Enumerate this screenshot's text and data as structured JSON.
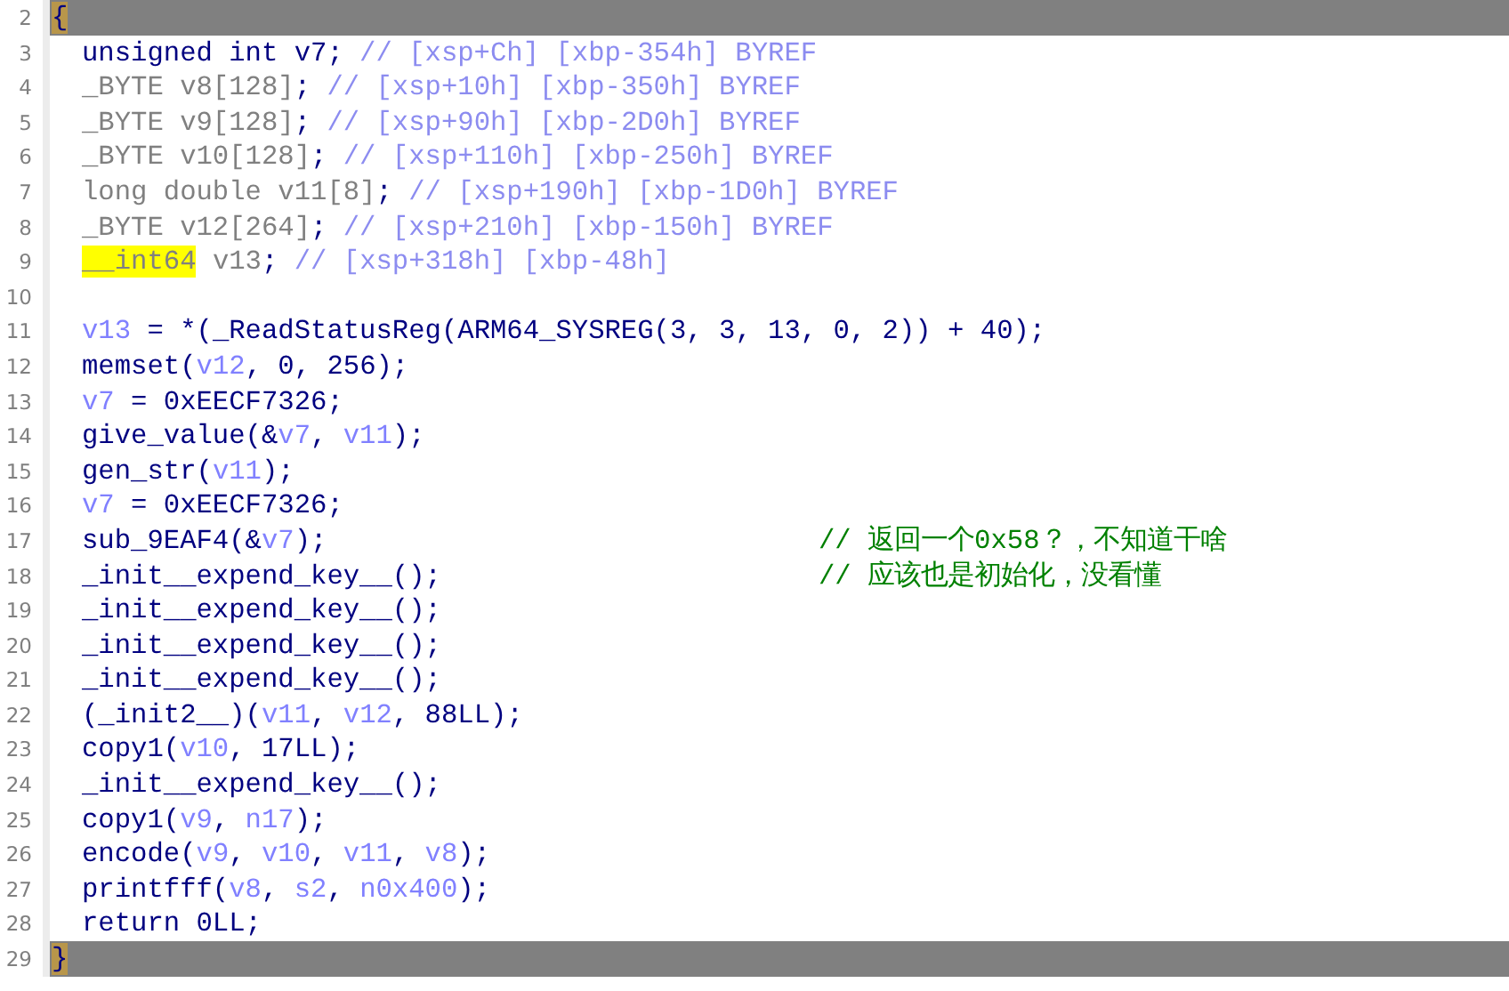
{
  "lines": [
    {
      "number": "2",
      "kind": "brace",
      "highlighted": true,
      "tokens": [
        {
          "kind": "plain",
          "text": "{",
          "cursor": true
        }
      ]
    },
    {
      "number": "3",
      "kind": "statement",
      "highlighted": false,
      "tokens": [
        {
          "kind": "keyword",
          "text": "unsigned int v7;"
        },
        {
          "kind": "comment",
          "text": " // [xsp+Ch] [xbp-354h] BYREF"
        }
      ]
    },
    {
      "number": "4",
      "kind": "statement",
      "highlighted": false,
      "tokens": [
        {
          "kind": "type",
          "text": "_BYTE v8[128]"
        },
        {
          "kind": "plain",
          "text": ";"
        },
        {
          "kind": "comment",
          "text": " // [xsp+10h] [xbp-350h] BYREF"
        }
      ]
    },
    {
      "number": "5",
      "kind": "statement",
      "highlighted": false,
      "tokens": [
        {
          "kind": "type",
          "text": "_BYTE v9[128]"
        },
        {
          "kind": "plain",
          "text": ";"
        },
        {
          "kind": "comment",
          "text": " // [xsp+90h] [xbp-2D0h] BYREF"
        }
      ]
    },
    {
      "number": "6",
      "kind": "statement",
      "highlighted": false,
      "tokens": [
        {
          "kind": "type",
          "text": "_BYTE v10[128]"
        },
        {
          "kind": "plain",
          "text": ";"
        },
        {
          "kind": "comment",
          "text": " // [xsp+110h] [xbp-250h] BYREF"
        }
      ]
    },
    {
      "number": "7",
      "kind": "statement",
      "highlighted": false,
      "tokens": [
        {
          "kind": "type",
          "text": "long double v11[8]"
        },
        {
          "kind": "plain",
          "text": ";"
        },
        {
          "kind": "comment",
          "text": " // [xsp+190h] [xbp-1D0h] BYREF"
        }
      ]
    },
    {
      "number": "8",
      "kind": "statement",
      "highlighted": false,
      "tokens": [
        {
          "kind": "type",
          "text": "_BYTE v12[264]"
        },
        {
          "kind": "plain",
          "text": ";"
        },
        {
          "kind": "comment",
          "text": " // [xsp+210h] [xbp-150h] BYREF"
        }
      ]
    },
    {
      "number": "9",
      "kind": "statement",
      "highlighted": false,
      "tokens": [
        {
          "kind": "type",
          "text": "__int64",
          "marked": true
        },
        {
          "kind": "type",
          "text": " v13"
        },
        {
          "kind": "plain",
          "text": ";"
        },
        {
          "kind": "comment",
          "text": " // [xsp+318h] [xbp-48h]"
        }
      ]
    },
    {
      "number": "10",
      "kind": "statement",
      "highlighted": false
    },
    {
      "number": "11",
      "kind": "statement",
      "highlighted": false,
      "tokens": [
        {
          "kind": "var",
          "text": "v13"
        },
        {
          "kind": "plain",
          "text": " = *(_ReadStatusReg(ARM64_SYSREG(3, 3, 13, 0, 2)) + 40);"
        }
      ]
    },
    {
      "number": "12",
      "kind": "statement",
      "highlighted": false,
      "tokens": [
        {
          "kind": "plain",
          "text": "memset("
        },
        {
          "kind": "var",
          "text": "v12"
        },
        {
          "kind": "plain",
          "text": ", 0, 256);"
        }
      ]
    },
    {
      "number": "13",
      "kind": "statement",
      "highlighted": false,
      "tokens": [
        {
          "kind": "var",
          "text": "v7"
        },
        {
          "kind": "plain",
          "text": " = 0xEECF7326;"
        }
      ]
    },
    {
      "number": "14",
      "kind": "statement",
      "highlighted": false,
      "tokens": [
        {
          "kind": "plain",
          "text": "give_value(&"
        },
        {
          "kind": "var",
          "text": "v7"
        },
        {
          "kind": "plain",
          "text": ", "
        },
        {
          "kind": "var",
          "text": "v11"
        },
        {
          "kind": "plain",
          "text": ");"
        }
      ]
    },
    {
      "number": "15",
      "kind": "statement",
      "highlighted": false,
      "tokens": [
        {
          "kind": "plain",
          "text": "gen_str("
        },
        {
          "kind": "var",
          "text": "v11"
        },
        {
          "kind": "plain",
          "text": ");"
        }
      ]
    },
    {
      "number": "16",
      "kind": "statement",
      "highlighted": false,
      "tokens": [
        {
          "kind": "var",
          "text": "v7"
        },
        {
          "kind": "plain",
          "text": " = 0xEECF7326;"
        }
      ]
    },
    {
      "number": "17",
      "kind": "statement",
      "highlighted": false,
      "tokens": [
        {
          "kind": "plain",
          "text": "sub_9EAF4(&"
        },
        {
          "kind": "var",
          "text": "v7"
        },
        {
          "kind": "plain",
          "text": ");"
        }
      ],
      "comment": "// 返回一个0x58？，不知道干啥"
    },
    {
      "number": "18",
      "kind": "statement",
      "highlighted": false,
      "tokens": [
        {
          "kind": "plain",
          "text": "_init__expend_key__();"
        }
      ],
      "comment": "// 应该也是初始化，没看懂"
    },
    {
      "number": "19",
      "kind": "statement",
      "highlighted": false,
      "tokens": [
        {
          "kind": "plain",
          "text": "_init__expend_key__();"
        }
      ]
    },
    {
      "number": "20",
      "kind": "statement",
      "highlighted": false,
      "tokens": [
        {
          "kind": "plain",
          "text": "_init__expend_key__();"
        }
      ]
    },
    {
      "number": "21",
      "kind": "statement",
      "highlighted": false,
      "tokens": [
        {
          "kind": "plain",
          "text": "_init__expend_key__();"
        }
      ]
    },
    {
      "number": "22",
      "kind": "statement",
      "highlighted": false,
      "tokens": [
        {
          "kind": "plain",
          "text": "(_init2__)("
        },
        {
          "kind": "var",
          "text": "v11"
        },
        {
          "kind": "plain",
          "text": ", "
        },
        {
          "kind": "var",
          "text": "v12"
        },
        {
          "kind": "plain",
          "text": ", 88LL);"
        }
      ]
    },
    {
      "number": "23",
      "kind": "statement",
      "highlighted": false,
      "tokens": [
        {
          "kind": "plain",
          "text": "copy1("
        },
        {
          "kind": "var",
          "text": "v10"
        },
        {
          "kind": "plain",
          "text": ", 17LL);"
        }
      ]
    },
    {
      "number": "24",
      "kind": "statement",
      "highlighted": false,
      "tokens": [
        {
          "kind": "plain",
          "text": "_init__expend_key__();"
        }
      ]
    },
    {
      "number": "25",
      "kind": "statement",
      "highlighted": false,
      "tokens": [
        {
          "kind": "plain",
          "text": "copy1("
        },
        {
          "kind": "var",
          "text": "v9"
        },
        {
          "kind": "plain",
          "text": ", "
        },
        {
          "kind": "var",
          "text": "n17"
        },
        {
          "kind": "plain",
          "text": ");"
        }
      ]
    },
    {
      "number": "26",
      "kind": "statement",
      "highlighted": false,
      "tokens": [
        {
          "kind": "plain",
          "text": "encode("
        },
        {
          "kind": "var",
          "text": "v9"
        },
        {
          "kind": "plain",
          "text": ", "
        },
        {
          "kind": "var",
          "text": "v10"
        },
        {
          "kind": "plain",
          "text": ", "
        },
        {
          "kind": "var",
          "text": "v11"
        },
        {
          "kind": "plain",
          "text": ", "
        },
        {
          "kind": "var",
          "text": "v8"
        },
        {
          "kind": "plain",
          "text": ");"
        }
      ]
    },
    {
      "number": "27",
      "kind": "statement",
      "highlighted": false,
      "tokens": [
        {
          "kind": "plain",
          "text": "printfff("
        },
        {
          "kind": "var",
          "text": "v8"
        },
        {
          "kind": "plain",
          "text": ", "
        },
        {
          "kind": "var",
          "text": "s2"
        },
        {
          "kind": "plain",
          "text": ", "
        },
        {
          "kind": "var",
          "text": "n0x400"
        },
        {
          "kind": "plain",
          "text": ");"
        }
      ]
    },
    {
      "number": "28",
      "kind": "statement",
      "highlighted": false,
      "tokens": [
        {
          "kind": "plain",
          "text": "return 0LL;"
        }
      ]
    },
    {
      "number": "29",
      "kind": "brace",
      "highlighted": true,
      "tokens": [
        {
          "kind": "plain",
          "text": "}",
          "cursor": true
        }
      ]
    }
  ]
}
